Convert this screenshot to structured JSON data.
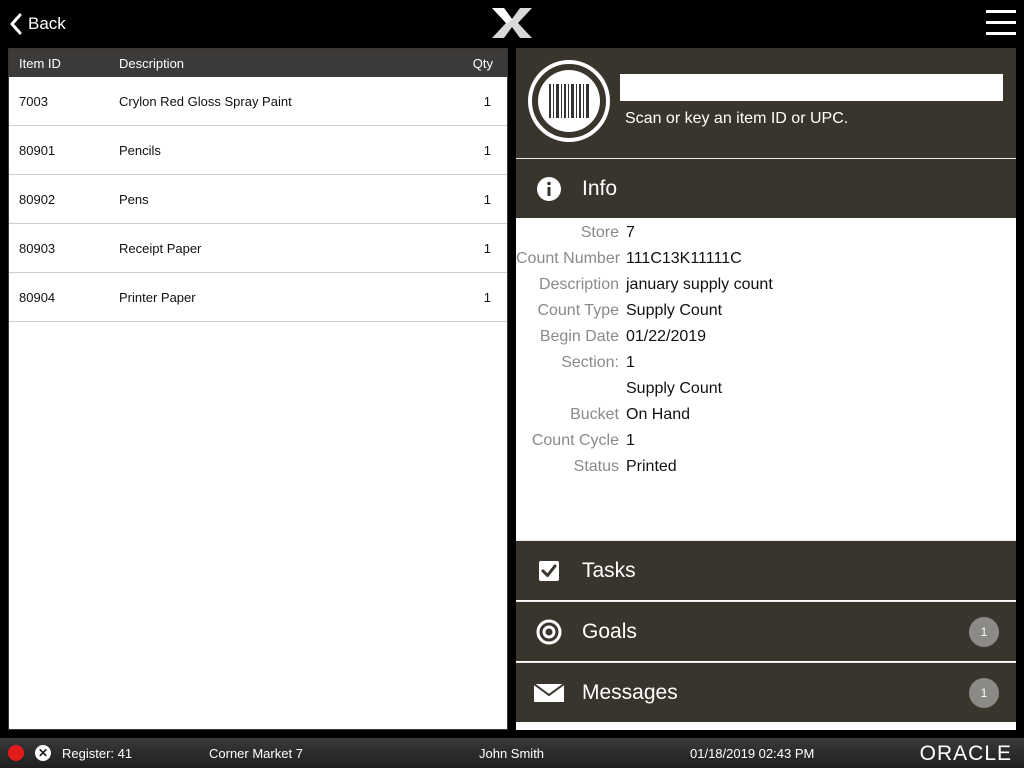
{
  "topbar": {
    "back_label": "Back",
    "logo_icon": "x-logo-icon",
    "menu_icon": "hamburger-menu-icon"
  },
  "table": {
    "columns": {
      "id": "Item ID",
      "desc": "Description",
      "qty": "Qty"
    },
    "rows": [
      {
        "id": "7003",
        "desc": "Crylon Red Gloss Spray Paint",
        "qty": "1"
      },
      {
        "id": "80901",
        "desc": "Pencils",
        "qty": "1"
      },
      {
        "id": "80902",
        "desc": "Pens",
        "qty": "1"
      },
      {
        "id": "80903",
        "desc": "Receipt Paper",
        "qty": "1"
      },
      {
        "id": "80904",
        "desc": "Printer Paper",
        "qty": "1"
      }
    ]
  },
  "scan": {
    "input_value": "",
    "hint": "Scan or key an item ID or UPC.",
    "icon": "barcode-icon"
  },
  "info": {
    "title": "Info",
    "icon": "info-icon",
    "fields": [
      {
        "k": "Store",
        "v": "7"
      },
      {
        "k": "Count Number",
        "v": "111C13K11111C"
      },
      {
        "k": "Description",
        "v": "january supply count"
      },
      {
        "k": "Count Type",
        "v": "Supply Count"
      },
      {
        "k": "Begin Date",
        "v": "01/22/2019"
      },
      {
        "k": "Section:",
        "v": "1"
      },
      {
        "k": "",
        "v": "Supply Count"
      },
      {
        "k": "Bucket",
        "v": "On Hand"
      },
      {
        "k": "Count Cycle",
        "v": "1"
      },
      {
        "k": "Status",
        "v": "Printed"
      }
    ]
  },
  "sections": {
    "tasks": {
      "label": "Tasks",
      "icon": "checkbox-icon"
    },
    "goals": {
      "label": "Goals",
      "icon": "target-icon",
      "badge": "1"
    },
    "messages": {
      "label": "Messages",
      "icon": "envelope-icon",
      "badge": "1"
    }
  },
  "status": {
    "register": "Register: 41",
    "store": "Corner Market 7",
    "user": "John Smith",
    "datetime": "01/18/2019 02:43 PM",
    "brand": "ORACLE",
    "dot_color": "#e21b1b"
  }
}
